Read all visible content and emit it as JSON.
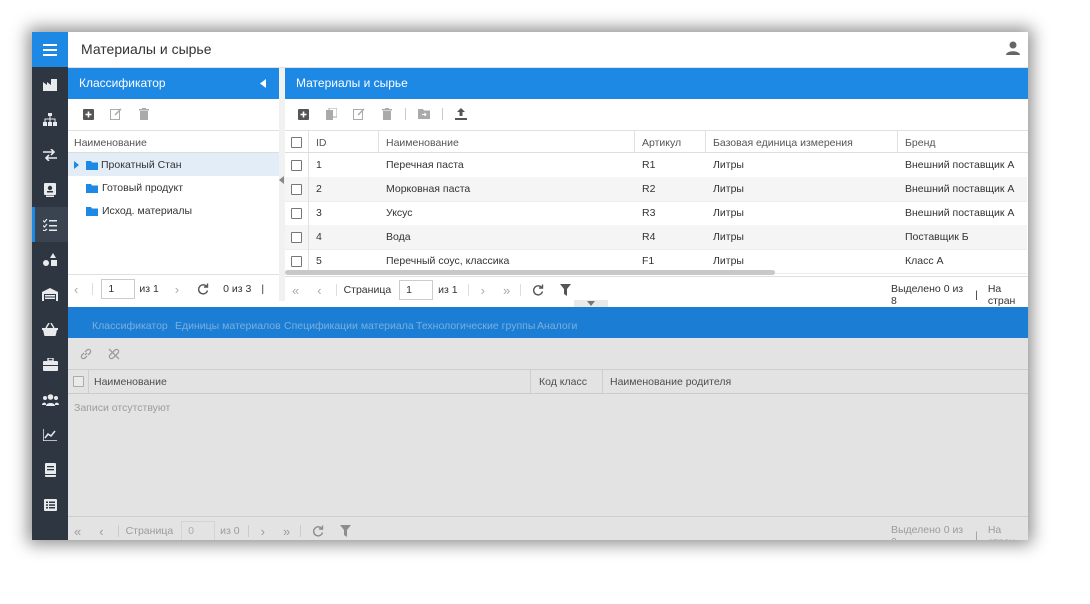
{
  "app": {
    "title": "Материалы и сырье"
  },
  "colors": {
    "accent": "#1e88e5",
    "rail": "#2e3641"
  },
  "rail": {
    "icons": [
      "menu-icon",
      "factory-icon",
      "hierarchy-icon",
      "transfer-icon",
      "monitor-icon",
      "checklist-icon",
      "shapes-icon",
      "warehouse-icon",
      "basket-icon",
      "briefcase-icon",
      "users-icon",
      "chart-icon",
      "book-icon",
      "list-icon"
    ]
  },
  "classifier": {
    "title": "Классификатор",
    "column": "Наименование",
    "items": [
      "Прокатный Стан",
      "Готовый продукт",
      "Исход. материалы"
    ],
    "pager": {
      "page": "1",
      "of": "из 1",
      "count": "0 из 3",
      "sep": "|"
    }
  },
  "materials": {
    "title": "Материалы и сырье",
    "columns": {
      "id": "ID",
      "name": "Наименование",
      "article": "Артикул",
      "unit": "Базовая единица измерения",
      "brand": "Бренд"
    },
    "rows": [
      {
        "id": "1",
        "name": "Перечная паста",
        "article": "R1",
        "unit": "Литры",
        "brand": "Внешний поставщик А"
      },
      {
        "id": "2",
        "name": "Морковная паста",
        "article": "R2",
        "unit": "Литры",
        "brand": "Внешний поставщик А"
      },
      {
        "id": "3",
        "name": "Уксус",
        "article": "R3",
        "unit": "Литры",
        "brand": "Внешний поставщик А"
      },
      {
        "id": "4",
        "name": "Вода",
        "article": "R4",
        "unit": "Литры",
        "brand": "Поставщик Б"
      },
      {
        "id": "5",
        "name": "Перечный соус, классика",
        "article": "F1",
        "unit": "Литры",
        "brand": "Класс А"
      }
    ],
    "pager": {
      "page_label": "Страница",
      "page": "1",
      "of": "из 1",
      "selected": "Выделено 0 из 8",
      "sep": "|",
      "per_page": "На стран"
    }
  },
  "bottom": {
    "tabs": [
      "Классификатор",
      "Единицы материалов",
      "Спецификации материала",
      "Технологические группы",
      "Аналоги"
    ],
    "columns": {
      "name": "Наименование",
      "code": "Код класс",
      "parent": "Наименование родителя"
    },
    "empty": "Записи отсутствуют",
    "pager": {
      "page_label": "Страница",
      "page": "0",
      "of": "из 0",
      "selected": "Выделено 0 из 0",
      "sep": "|",
      "per_page": "На стран"
    }
  }
}
